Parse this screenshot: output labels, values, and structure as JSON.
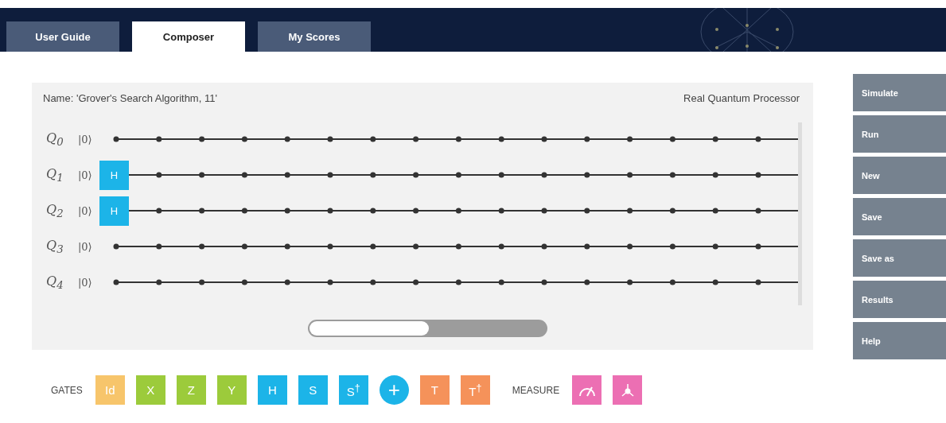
{
  "tabs": [
    {
      "label": "User Guide",
      "selected": false
    },
    {
      "label": "Composer",
      "selected": true
    },
    {
      "label": "My Scores",
      "selected": false
    }
  ],
  "circuit": {
    "name": "Name: 'Grover's Search Algorithm, 11'",
    "backend": "Real Quantum Processor",
    "qubits": [
      {
        "label": "Q$_{0}$",
        "ket": "|0⟩"
      },
      {
        "label": "Q$_{1}$",
        "ket": "|0⟩",
        "gate": {
          "label": "H",
          "color": "#1cb4e8"
        }
      },
      {
        "label": "Q$_{2}$",
        "ket": "|0⟩",
        "gate": {
          "label": "H",
          "color": "#1cb4e8"
        }
      },
      {
        "label": "Q$_{3}$",
        "ket": "|0⟩"
      },
      {
        "label": "Q$_{4}$",
        "ket": "|0⟩"
      }
    ]
  },
  "actions": [
    "Simulate",
    "Run",
    "New",
    "Save",
    "Save as",
    "Results",
    "Help"
  ],
  "gates": {
    "label": "GATES",
    "items": [
      {
        "label": "Id",
        "kind": "square",
        "color": "#f7c56b"
      },
      {
        "label": "X",
        "kind": "square",
        "color": "#9ccb3b"
      },
      {
        "label": "Z",
        "kind": "square",
        "color": "#9ccb3b"
      },
      {
        "label": "Y",
        "kind": "square",
        "color": "#9ccb3b"
      },
      {
        "label": "H",
        "kind": "square",
        "color": "#1cb4e8"
      },
      {
        "label": "S",
        "kind": "square",
        "color": "#1cb4e8"
      },
      {
        "label": "S$^{†}$",
        "kind": "square",
        "color": "#1cb4e8"
      },
      {
        "label": "+",
        "kind": "circle",
        "color": "#1cb4e8"
      },
      {
        "label": "T",
        "kind": "square",
        "color": "#f5925a"
      },
      {
        "label": "T$^{†}$",
        "kind": "square",
        "color": "#f5925a"
      }
    ]
  },
  "measure": {
    "label": "MEASURE",
    "items": [
      {
        "kind": "meter",
        "color": "#ec6fb3"
      },
      {
        "kind": "bloch",
        "color": "#ec6fb3"
      }
    ]
  }
}
